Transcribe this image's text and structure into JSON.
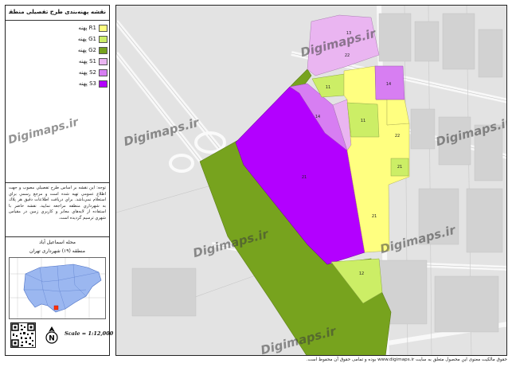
{
  "title": "نقشه پهنه‌بندی طرح تفصیلی منطقه",
  "legend": [
    {
      "label": "پهنه R1",
      "code": "R1",
      "color": "#ffff80"
    },
    {
      "label": "پهنه G1",
      "code": "G1",
      "color": "#ccee66"
    },
    {
      "label": "پهنه G2",
      "code": "G2",
      "color": "#77a31e"
    },
    {
      "label": "پهنه S1",
      "code": "S1",
      "color": "#eab5f1"
    },
    {
      "label": "پهنه S2",
      "code": "S2",
      "color": "#d77ef2"
    },
    {
      "label": "پهنه S3",
      "code": "S3",
      "color": "#b300ff"
    }
  ],
  "note": "توجه: اين نقشه بر اساس طرح تفصيلي مصوب و جهت اطلاع عمومي تهيه شده است و مرجع رسمي براي استعلام نمي‌باشد. براي دريافت اطلاعات دقيق هر پلاك به شهرداري منطقه مراجعه نماييد. نقشه حاضر با استفاده از لايه‌هاي معابر و كاربري زمين در مقياس شهري ترسيم گرديده است.",
  "district": {
    "neighborhood": "محله اسماعیل آباد",
    "municipality": "منطقه (۱۹) شهرداری تهران"
  },
  "scale": "Scale = 1:12,000",
  "watermark": "Digimaps.ir",
  "copyright": "حقوق مالکیت معنوی این محصول متعلق به سایت www.digimaps.ir بوده و تمامی حقوق آن محفوظ است.",
  "map_labels": [
    {
      "text": "22",
      "zone": "S1"
    },
    {
      "text": "11",
      "zone": "G1"
    },
    {
      "text": "14",
      "zone": "S2"
    },
    {
      "text": "14",
      "zone": "S1"
    },
    {
      "text": "11",
      "zone": "G1"
    },
    {
      "text": "22",
      "zone": "R1"
    },
    {
      "text": "21",
      "zone": "S3"
    },
    {
      "text": "21",
      "zone": "R1"
    },
    {
      "text": "21",
      "zone": "R1"
    },
    {
      "text": "12",
      "zone": "G1"
    },
    {
      "text": "13",
      "zone": "S1"
    }
  ]
}
